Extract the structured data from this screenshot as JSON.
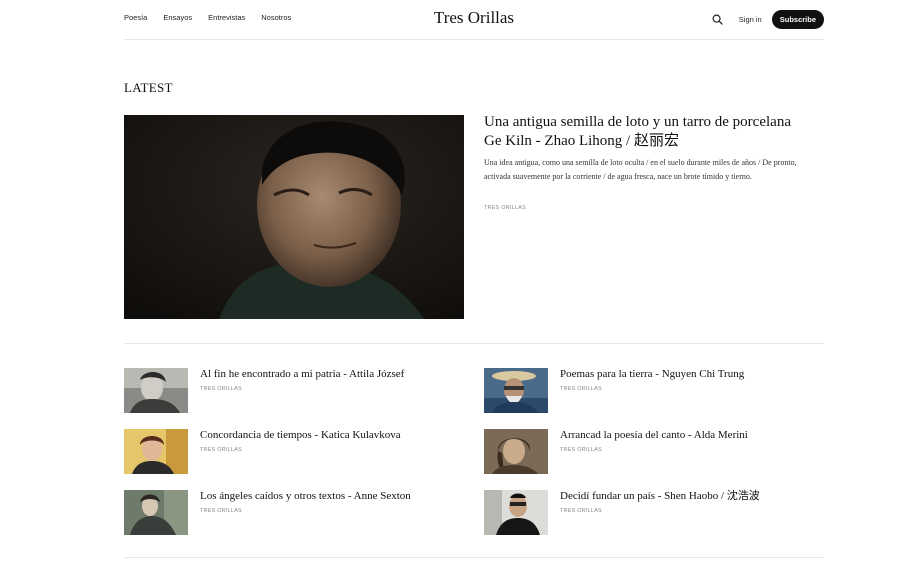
{
  "header": {
    "nav": [
      "Poesía",
      "Ensayos",
      "Entrevistas",
      "Nosotros"
    ],
    "brand": "Tres Orillas",
    "search_icon": "search-icon",
    "signin": "Sign in",
    "subscribe": "Subscribe"
  },
  "section": {
    "label": "LATEST"
  },
  "feature": {
    "title": "Una antigua semilla de loto y un tarro de porcelana Ge Kiln - Zhao Lihong / 赵丽宏",
    "excerpt": "Una idea antigua, como una semilla de loto oculta / en el suelo durante miles de años / De pronto, activada suavemente por la corriente / de agua fresca, nace un brote tímido y tierno.",
    "author": "TRES ORILLAS"
  },
  "posts": [
    {
      "title": "Al fin he encontrado a mi patria - Attila József",
      "author": "TRES ORILLAS"
    },
    {
      "title": "Poemas para la tierra - Nguyen Chi Trung",
      "author": "TRES ORILLAS"
    },
    {
      "title": "Concordancia de tiempos - Katica Kulavkova",
      "author": "TRES ORILLAS"
    },
    {
      "title": "Arrancad la poesía del canto - Alda Merini",
      "author": "TRES ORILLAS"
    },
    {
      "title": "Los ángeles caídos y otros textos - Anne Sexton",
      "author": "TRES ORILLAS"
    },
    {
      "title": "Decidí fundar un país - Shen Haobo / 沈浩波",
      "author": "TRES ORILLAS"
    }
  ]
}
